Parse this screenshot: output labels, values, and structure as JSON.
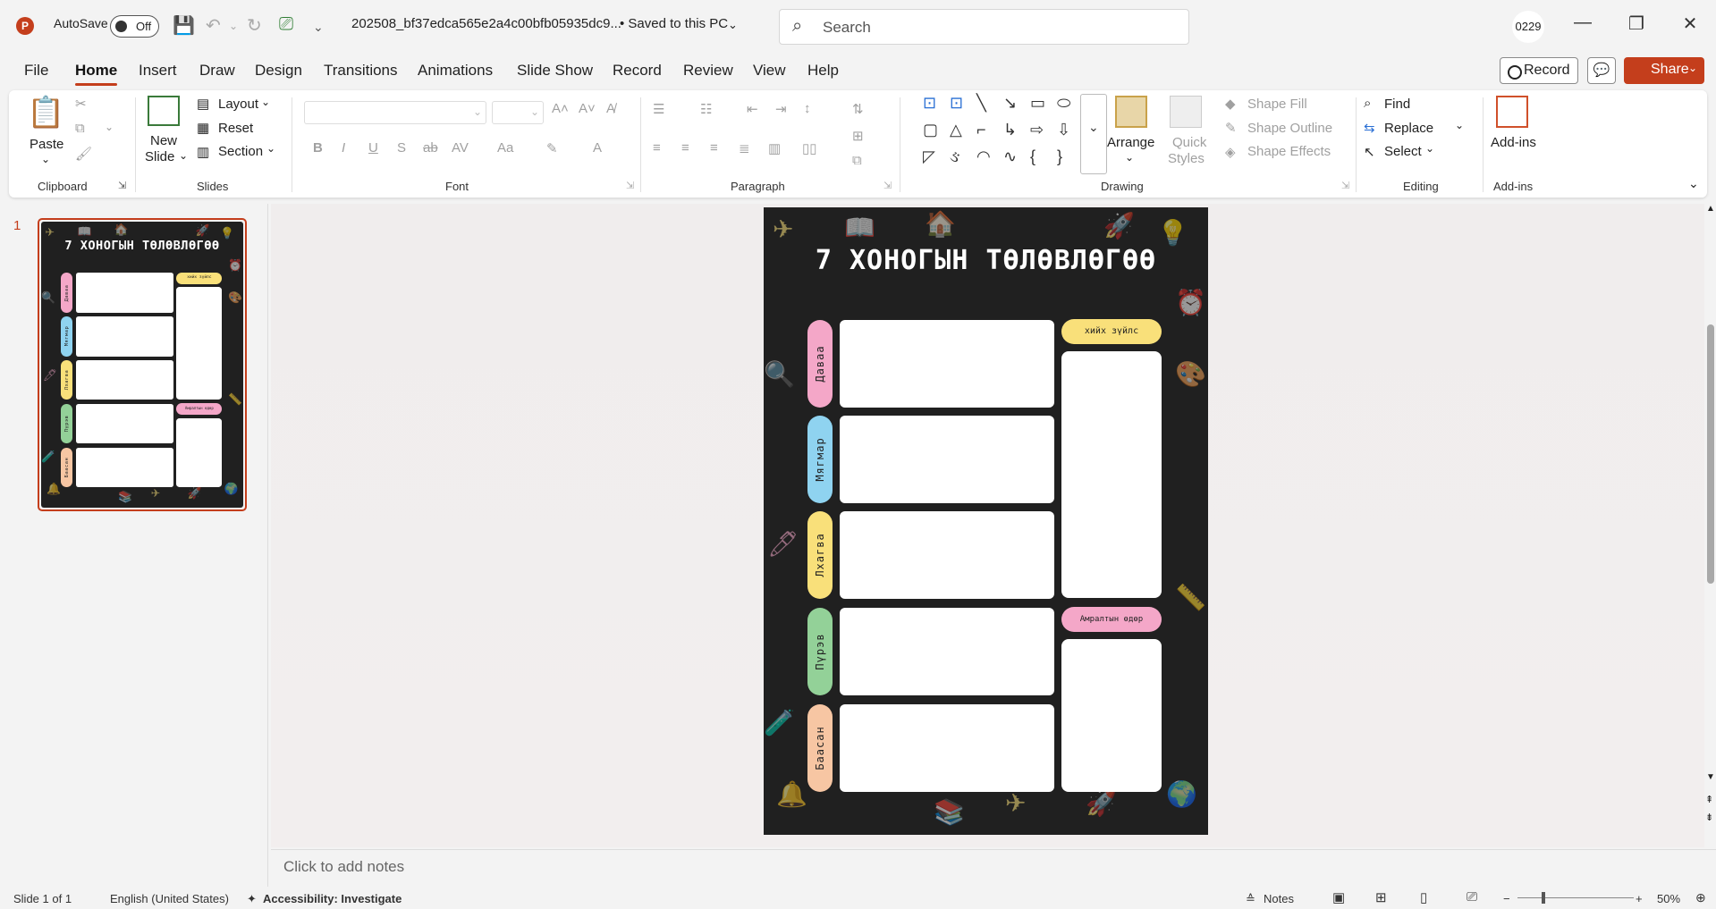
{
  "titlebar": {
    "autosave_label": "AutoSave",
    "autosave_state": "Off",
    "file_name": "202508_bf37edca565e2a4c00bfb05935dc9...",
    "save_status": "•  Saved to this PC",
    "search_placeholder": "Search",
    "user_initials": "0229"
  },
  "menu": {
    "file": "File",
    "home": "Home",
    "insert": "Insert",
    "draw": "Draw",
    "design": "Design",
    "transitions": "Transitions",
    "animations": "Animations",
    "slideshow": "Slide Show",
    "record": "Record",
    "review": "Review",
    "view": "View",
    "help": "Help",
    "record_button": "Record",
    "share_button": "Share"
  },
  "ribbon": {
    "paste": "Paste",
    "clipboard": "Clipboard",
    "new_slide_1": "New",
    "new_slide_2": "Slide",
    "layout": "Layout",
    "reset": "Reset",
    "section": "Section",
    "slides": "Slides",
    "font": "Font",
    "paragraph": "Paragraph",
    "arrange": "Arrange",
    "quick_styles_1": "Quick",
    "quick_styles_2": "Styles",
    "shape_fill": "Shape Fill",
    "shape_outline": "Shape Outline",
    "shape_effects": "Shape Effects",
    "drawing": "Drawing",
    "find": "Find",
    "replace": "Replace",
    "select": "Select",
    "editing": "Editing",
    "addins_btn": "Add-ins",
    "addins": "Add-ins"
  },
  "thumbnails": {
    "slide_number": "1"
  },
  "slide": {
    "title": "7 ХОНОГЫН ТӨЛӨВЛӨГӨӨ",
    "days": [
      "Даваа",
      "Мягмар",
      "Лхагва",
      "Пүрэв",
      "Баасан"
    ],
    "todo_label": "хийх зүйлс",
    "rest_label": "Амралтын өдөр",
    "colors": {
      "background": "#202020",
      "pink": "#f4a7c8",
      "blue": "#8fd3f0",
      "yellow": "#f9e07a",
      "green": "#93d198",
      "peach": "#f7c6a3"
    }
  },
  "notes": {
    "placeholder": "Click to add notes"
  },
  "status": {
    "slide_info": "Slide 1 of 1",
    "language": "English (United States)",
    "accessibility": "Accessibility: Investigate",
    "notes": "Notes",
    "zoom": "50%"
  }
}
